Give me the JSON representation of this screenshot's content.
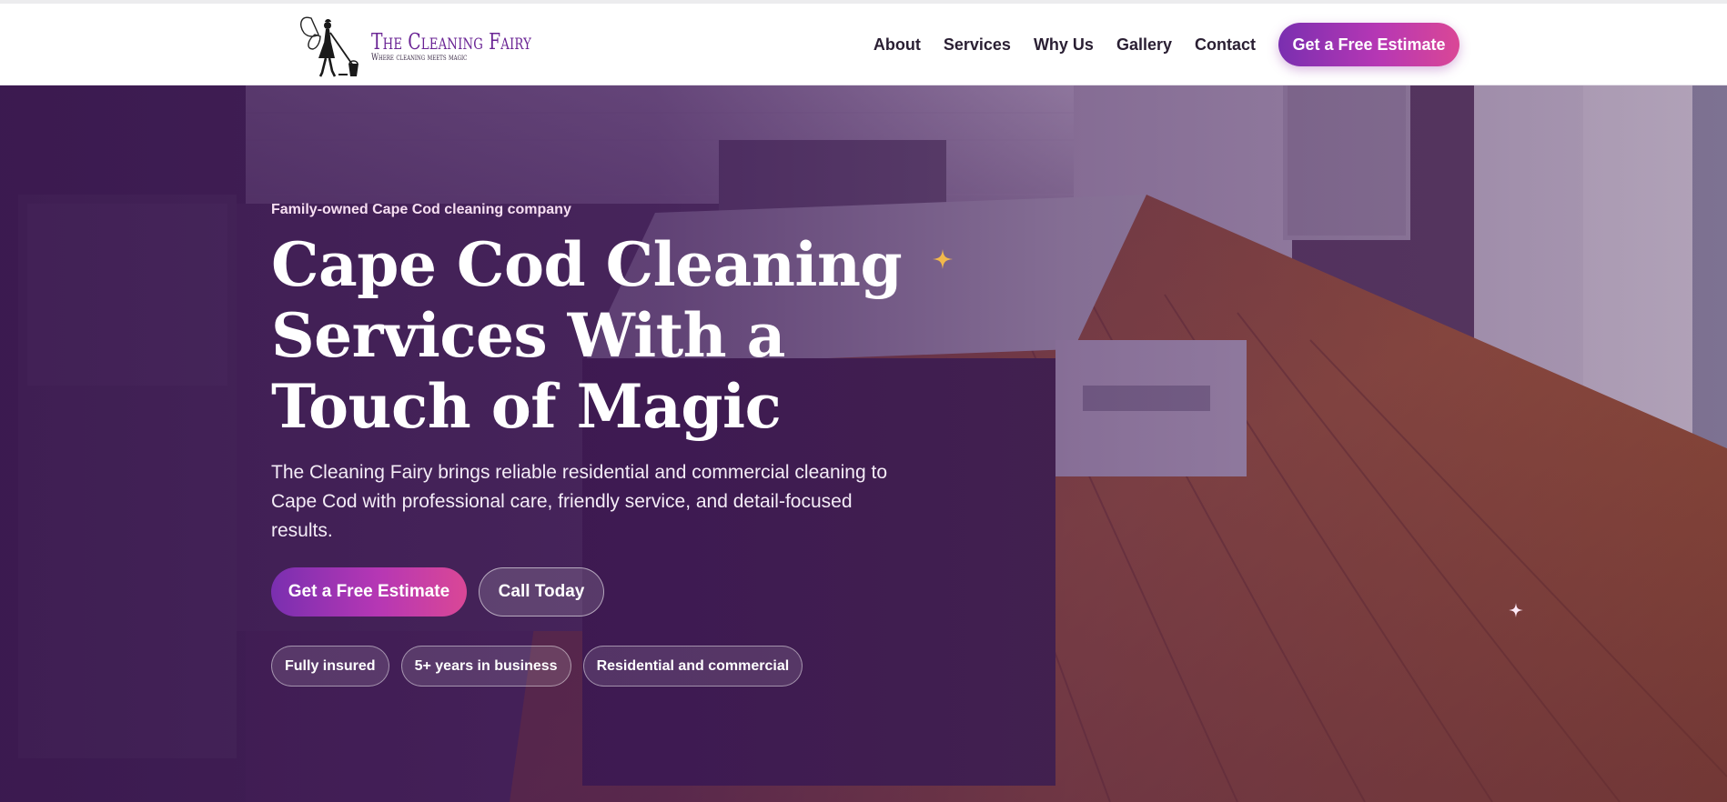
{
  "brand": {
    "name": "The Cleaning Fairy",
    "tagline": "Where cleaning meets magic"
  },
  "nav": {
    "links": [
      {
        "label": "About"
      },
      {
        "label": "Services"
      },
      {
        "label": "Why Us"
      },
      {
        "label": "Gallery"
      },
      {
        "label": "Contact"
      }
    ],
    "cta_label": "Get a Free Estimate"
  },
  "hero": {
    "eyebrow": "Family-owned Cape Cod cleaning company",
    "headline_lines": [
      "Cape Cod Cleaning",
      "Services With a",
      "Touch of Magic"
    ],
    "description": "The Cleaning Fairy brings reliable residential and commercial cleaning to Cape Cod with professional care, friendly service, and detail-focused results.",
    "primary_cta": "Get a Free Estimate",
    "secondary_cta": "Call Today",
    "badges": [
      "Fully insured",
      "5+ years in business",
      "Residential and commercial"
    ]
  },
  "colors": {
    "brand_purple": "#6a2494",
    "gradient_start": "#7a2fb0",
    "gradient_end": "#da4796",
    "sparkle_gold": "#f2b84b"
  },
  "icons": {
    "logo_mark": "fairy-with-mop-icon",
    "sparkles": [
      "sparkle-icon",
      "sparkle-icon"
    ]
  }
}
